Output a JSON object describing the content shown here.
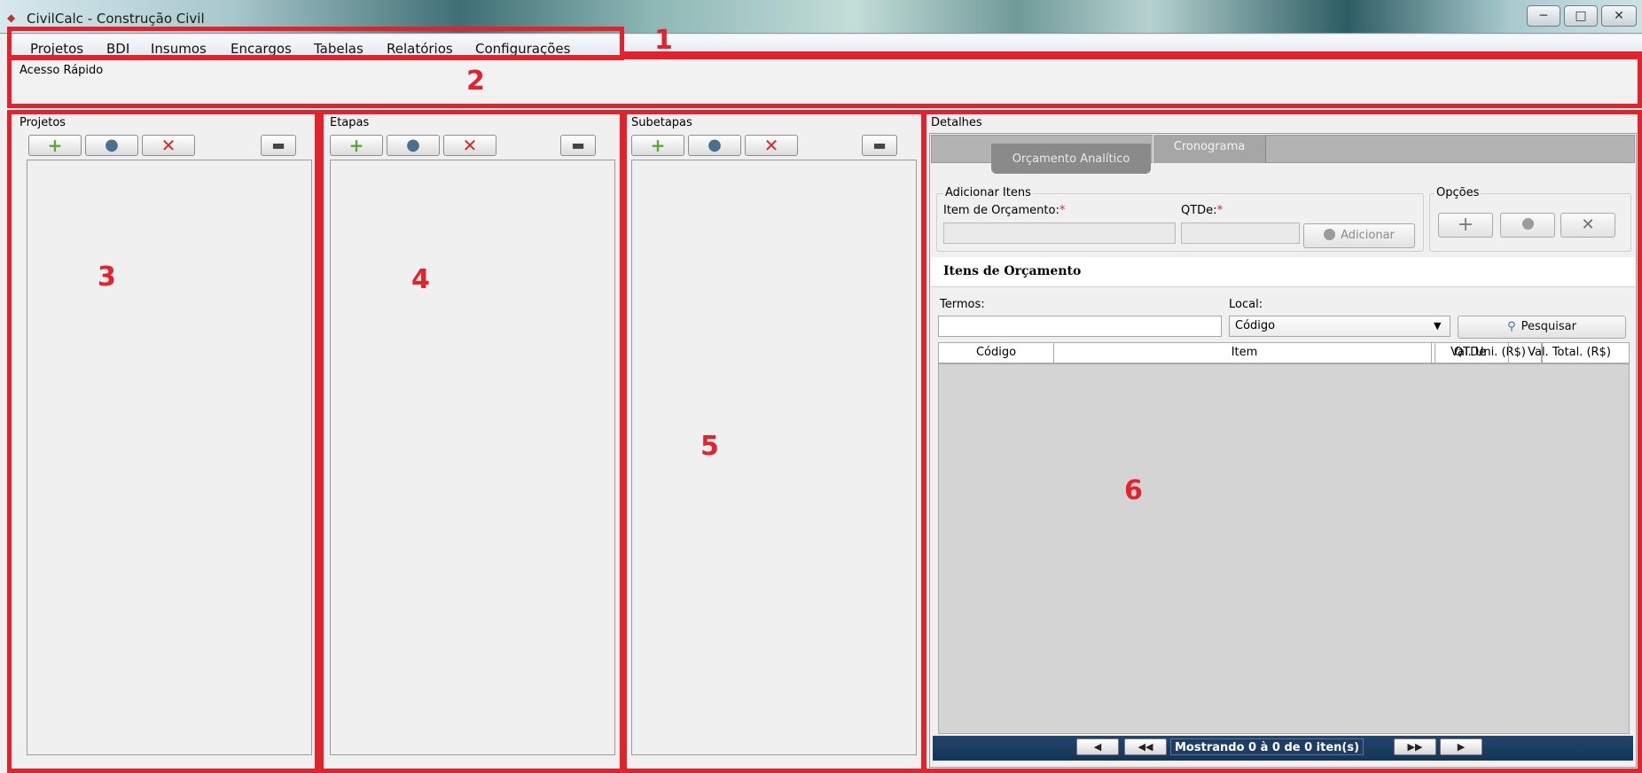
{
  "window": {
    "title": "CivilCalc - Construção Civil",
    "minimize_symbol": "─",
    "maximize_symbol": "□",
    "close_symbol": "✕"
  },
  "menu": {
    "items": [
      "Projetos",
      "BDI",
      "Insumos",
      "Encargos",
      "Tabelas",
      "Relatórios",
      "Configurações"
    ]
  },
  "quick_access": {
    "label": "Acesso Rápido"
  },
  "panels": {
    "projetos": {
      "label": "Projetos"
    },
    "etapas": {
      "label": "Etapas"
    },
    "subetapas": {
      "label": "Subetapas"
    }
  },
  "details": {
    "label": "Detalhes",
    "tabs": [
      {
        "label": "Orçamento Analítico",
        "active": true
      },
      {
        "label": "Cronograma",
        "active": false
      }
    ],
    "add_items": {
      "group_label": "Adicionar Itens",
      "item_label": "Item de Orçamento:",
      "qty_label": "QTDe:",
      "required_mark": "*",
      "add_button": "Adicionar"
    },
    "options": {
      "group_label": "Opções"
    },
    "items_section": {
      "title": "Itens de Orçamento",
      "terms_label": "Termos:",
      "local_label": "Local:",
      "local_selected": "Código",
      "search_button": "Pesquisar",
      "columns": [
        "Código",
        "Item",
        "Val. Uni. (R$)",
        "QTDe",
        "Val. Total. (R$)"
      ],
      "rows": []
    },
    "pager": {
      "status": "Mostrando 0 à 0 de 0 iten(s)"
    }
  },
  "annotations": [
    "1",
    "2",
    "3",
    "4",
    "5",
    "6"
  ],
  "colors": {
    "annotation_red": "#e3222b",
    "add_icon_green": "#5aa637",
    "delete_icon_red": "#d12a2a",
    "pager_blue": "#1f3c63"
  }
}
